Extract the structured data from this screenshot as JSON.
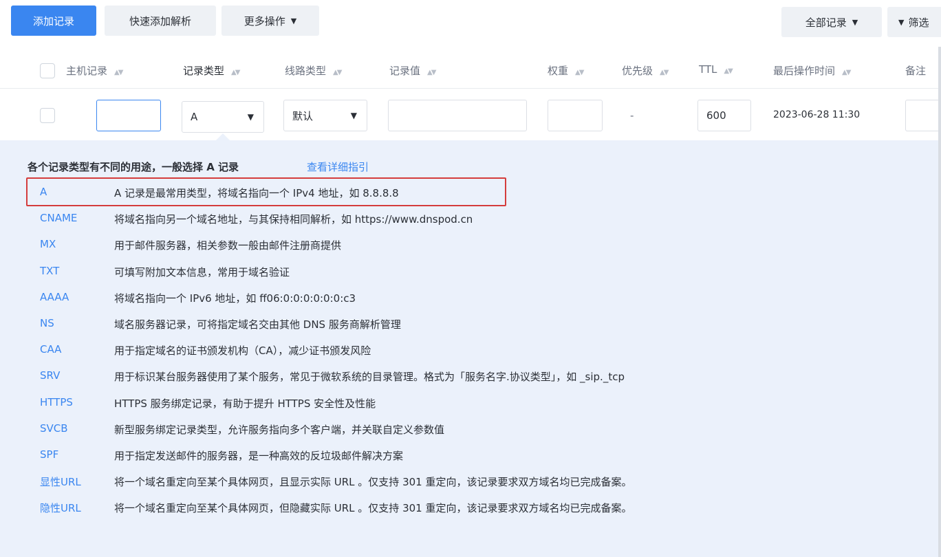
{
  "toolbar": {
    "add_record": "添加记录",
    "quick_add": "快速添加解析",
    "more_actions": "更多操作",
    "all_records": "全部记录",
    "filter": "筛选"
  },
  "table": {
    "headers": {
      "host": "主机记录",
      "type": "记录类型",
      "line": "线路类型",
      "value": "记录值",
      "weight": "权重",
      "priority": "优先级",
      "ttl": "TTL",
      "last_modified": "最后操作时间",
      "remark": "备注"
    },
    "edit_row": {
      "host": "",
      "type": "A",
      "line": "默认",
      "value": "",
      "weight": "",
      "priority": "-",
      "ttl": "600",
      "last_modified": "2023-06-28 11:30",
      "remark": ""
    }
  },
  "help": {
    "title": "各个记录类型有不同的用途，一般选择 A 记录",
    "link": "查看详细指引",
    "records": [
      {
        "type": "A",
        "desc": "A 记录是最常用类型，将域名指向一个 IPv4 地址，如 8.8.8.8"
      },
      {
        "type": "CNAME",
        "desc": "将域名指向另一个域名地址，与其保持相同解析，如 https://www.dnspod.cn"
      },
      {
        "type": "MX",
        "desc": "用于邮件服务器，相关参数一般由邮件注册商提供"
      },
      {
        "type": "TXT",
        "desc": "可填写附加文本信息，常用于域名验证"
      },
      {
        "type": "AAAA",
        "desc": "将域名指向一个 IPv6 地址，如 ff06:0:0:0:0:0:0:c3"
      },
      {
        "type": "NS",
        "desc": "域名服务器记录，可将指定域名交由其他 DNS 服务商解析管理"
      },
      {
        "type": "CAA",
        "desc": "用于指定域名的证书颁发机构（CA），减少证书颁发风险"
      },
      {
        "type": "SRV",
        "desc": "用于标识某台服务器使用了某个服务，常见于微软系统的目录管理。格式为「服务名字.协议类型」，如 _sip._tcp"
      },
      {
        "type": "HTTPS",
        "desc": "HTTPS 服务绑定记录，有助于提升 HTTPS 安全性及性能"
      },
      {
        "type": "SVCB",
        "desc": "新型服务绑定记录类型，允许服务指向多个客户端，并关联自定义参数值"
      },
      {
        "type": "SPF",
        "desc": "用于指定发送邮件的服务器，是一种高效的反垃圾邮件解决方案"
      },
      {
        "type": "显性URL",
        "desc": "将一个域名重定向至某个具体网页，且显示实际 URL 。仅支持 301 重定向，该记录要求双方域名均已完成备案。"
      },
      {
        "type": "隐性URL",
        "desc": "将一个域名重定向至某个具体网页，但隐藏实际 URL 。仅支持 301 重定向，该记录要求双方域名均已完成备案。"
      }
    ]
  },
  "colors": {
    "primary": "#3a86f0",
    "panel": "#ebf1fb",
    "highlight": "#d43c3c"
  }
}
